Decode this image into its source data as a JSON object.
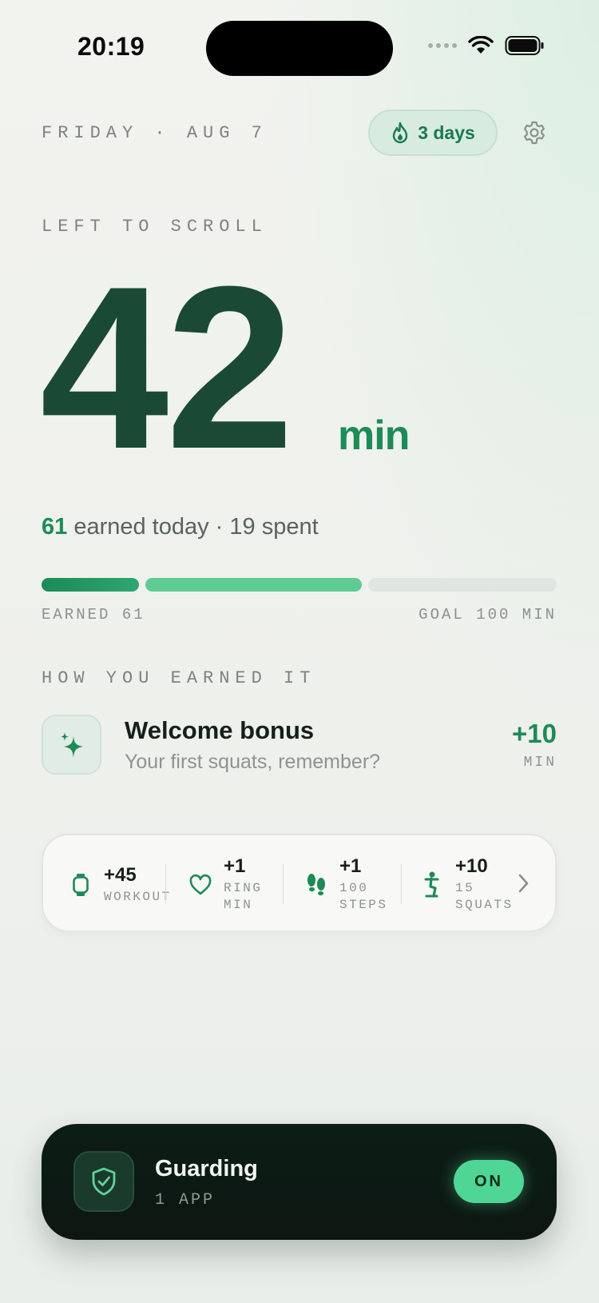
{
  "status_bar": {
    "time": "20:19"
  },
  "header": {
    "date": "FRIDAY · AUG 7",
    "streak": "3 days"
  },
  "balance": {
    "label": "LEFT TO SCROLL",
    "value": "42",
    "unit": "min"
  },
  "summary": {
    "earned": "61",
    "rest": " earned today · 19 spent"
  },
  "progress": {
    "earned_label": "EARNED 61",
    "goal_label": "GOAL 100 MIN",
    "earned": 61,
    "spent": 19,
    "goal": 100
  },
  "earnings": {
    "label": "HOW YOU EARNED IT",
    "items": [
      {
        "icon": "sparkle-icon",
        "title": "Welcome bonus",
        "subtitle": "Your first squats, remember?",
        "value": "+10",
        "unit": "MIN"
      }
    ]
  },
  "stats": [
    {
      "icon": "watch-icon",
      "value": "+45",
      "label": "WORKOUT"
    },
    {
      "icon": "heart-icon",
      "value": "+1",
      "label": "RING MIN"
    },
    {
      "icon": "footprints-icon",
      "value": "+1",
      "label": "100 STEPS"
    },
    {
      "icon": "squat-icon",
      "value": "+10",
      "label": "15 SQUATS"
    }
  ],
  "guard": {
    "title": "Guarding",
    "subtitle": "1 APP",
    "toggle": "ON"
  },
  "colors": {
    "accent": "#1d8b57",
    "number": "#1a4a33",
    "toggle": "#4fd696",
    "dark_card": "#0e1612"
  }
}
